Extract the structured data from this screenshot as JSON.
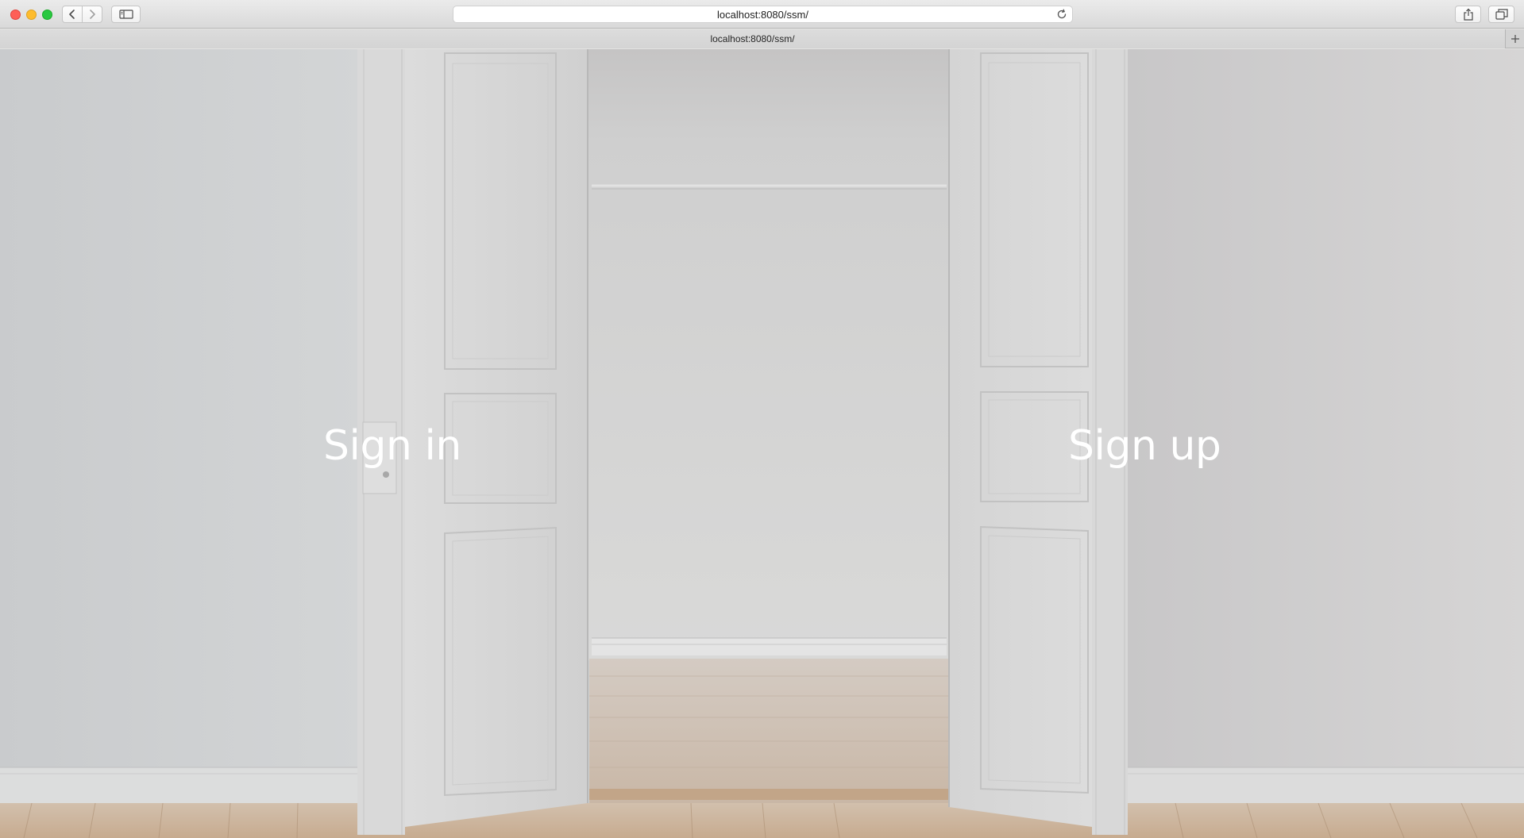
{
  "browser": {
    "url": "localhost:8080/ssm/",
    "tab_title": "localhost:8080/ssm/"
  },
  "icons": {
    "back": "chevron-left-icon",
    "forward": "chevron-right-icon",
    "sidebar": "sidebar-icon",
    "reload": "reload-icon",
    "share": "share-icon",
    "tabs": "tabs-overview-icon",
    "new_tab": "plus-icon"
  },
  "hero": {
    "sign_in": "Sign in",
    "sign_up": "Sign up"
  },
  "colors": {
    "hero_text": "#ffffff",
    "wall": "#d0d2d3",
    "floor": "#c9a98a"
  }
}
